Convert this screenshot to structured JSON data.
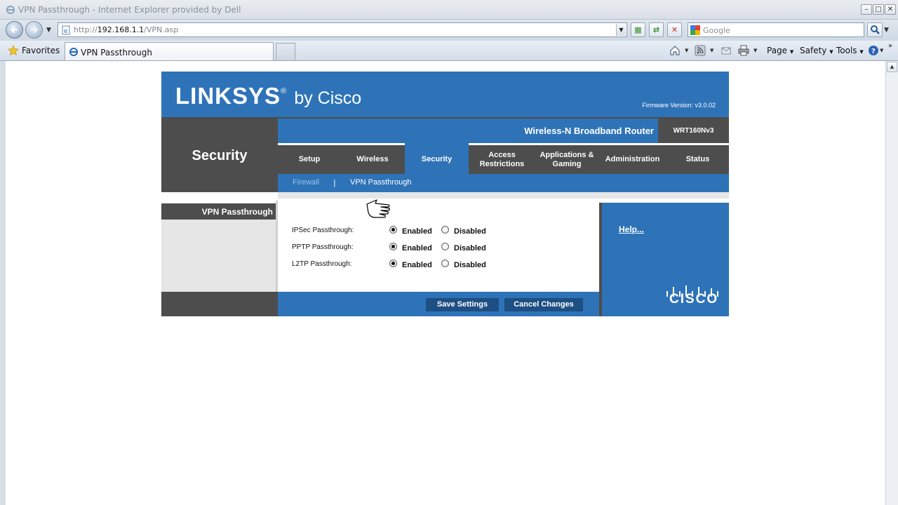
{
  "browser": {
    "window_title": "VPN Passthrough - Internet Explorer provided by Dell",
    "url_prefix": "http://",
    "url_host": "192.168.1.1",
    "url_path": "/VPN.asp",
    "search_placeholder": "Google",
    "favorites_label": "Favorites",
    "tab_title": "VPN Passthrough",
    "commands": {
      "page": "Page",
      "safety": "Safety",
      "tools": "Tools"
    }
  },
  "router": {
    "brand": "LINKSYS",
    "brand_suffix": "by Cisco",
    "firmware_label": "Firmware Version:",
    "firmware_version": "v3.0.02",
    "product_name": "Wireless-N Broadband Router",
    "model": "WRT160Nv3",
    "section_title": "Security",
    "tabs": [
      {
        "label_line1": "Setup",
        "label_line2": ""
      },
      {
        "label_line1": "Wireless",
        "label_line2": ""
      },
      {
        "label_line1": "Security",
        "label_line2": ""
      },
      {
        "label_line1": "Access",
        "label_line2": "Restrictions"
      },
      {
        "label_line1": "Applications &",
        "label_line2": "Gaming"
      },
      {
        "label_line1": "Administration",
        "label_line2": ""
      },
      {
        "label_line1": "Status",
        "label_line2": ""
      }
    ],
    "active_tab": "Security",
    "subnav": {
      "firewall": "Firewall",
      "separator": "|",
      "vpn": "VPN Passthrough"
    },
    "left_section_label": "VPN Passthrough",
    "settings": [
      {
        "label": "IPSec Passthrough:",
        "enabled_label": "Enabled",
        "disabled_label": "Disabled",
        "value": "Enabled"
      },
      {
        "label": "PPTP Passthrough:",
        "enabled_label": "Enabled",
        "disabled_label": "Disabled",
        "value": "Enabled"
      },
      {
        "label": "L2TP Passthrough:",
        "enabled_label": "Enabled",
        "disabled_label": "Disabled",
        "value": "Enabled"
      }
    ],
    "help_link": "Help...",
    "cisco_wordmark": "CISCO",
    "buttons": {
      "save": "Save Settings",
      "cancel": "Cancel Changes"
    },
    "colors": {
      "blue": "#2e73b8",
      "gray": "#4d4d4d",
      "button": "#1d4f83"
    }
  }
}
